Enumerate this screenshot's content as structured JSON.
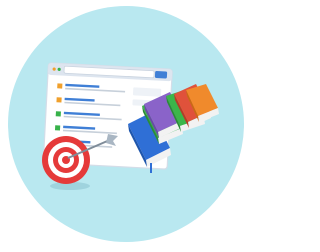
{
  "illustration": {
    "colors": {
      "background_circle": "#b9e8f0",
      "window_frame": "#e9eef5",
      "window_header": "#dde5ef",
      "link_blue": "#3f7fd6",
      "link_orange": "#f0a02c",
      "link_green": "#38b24a",
      "target_red": "#e53a3a",
      "arrow_gray": "#8c9aa8",
      "book_blue": "#2f6fd6",
      "book_green": "#3cb64a",
      "book_purple": "#8a63c9",
      "book_red": "#e0523b",
      "book_orange": "#f08a2c"
    },
    "search_results": {
      "count": 4,
      "marker_colors": [
        "orange",
        "orange",
        "green",
        "green"
      ]
    }
  }
}
